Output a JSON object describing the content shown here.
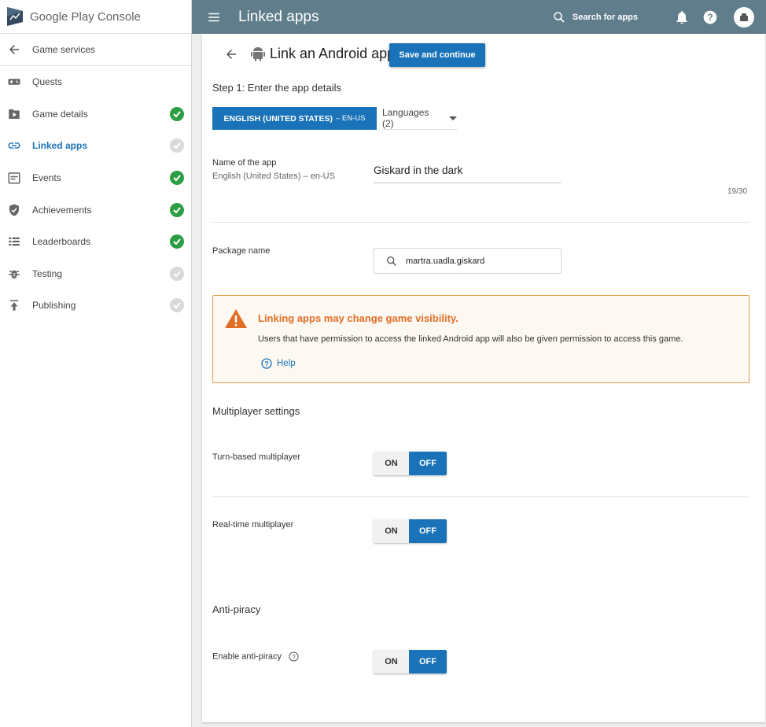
{
  "app": {
    "brand": "Google Play Console"
  },
  "sidebar": {
    "back_label": "Game services",
    "items": [
      {
        "label": "Quests",
        "icon": "gamepad-icon",
        "status": "none"
      },
      {
        "label": "Game details",
        "icon": "play-box-icon",
        "status": "complete"
      },
      {
        "label": "Linked apps",
        "icon": "link-icon",
        "status": "incomplete",
        "active": true
      },
      {
        "label": "Events",
        "icon": "events-icon",
        "status": "complete"
      },
      {
        "label": "Achievements",
        "icon": "shield-icon",
        "status": "complete"
      },
      {
        "label": "Leaderboards",
        "icon": "list-icon",
        "status": "complete"
      },
      {
        "label": "Testing",
        "icon": "bug-icon",
        "status": "incomplete"
      },
      {
        "label": "Publishing",
        "icon": "publish-icon",
        "status": "incomplete"
      }
    ]
  },
  "topbar": {
    "title": "Linked apps",
    "search_label": "Search for apps",
    "color": "#607d8b"
  },
  "page": {
    "title": "Link an Android app",
    "save_label": "Save and continue",
    "step_label": "Step 1: Enter the app details",
    "language_tab": {
      "label": "ENGLISH (UNITED STATES)",
      "suffix": "– EN-US"
    },
    "languages_dropdown": "Languages (2)",
    "app_name": {
      "label": "Name of the app",
      "sublabel": "English (United States) – en-US",
      "value": "Giskard in the dark",
      "counter": "19/30"
    },
    "package": {
      "label": "Package name",
      "value": "martra.uadla.giskard"
    },
    "warning": {
      "title": "Linking apps may change game visibility.",
      "body": "Users that have permission to access the linked Android app will also be given permission to access this game.",
      "help": "Help"
    },
    "multiplayer": {
      "title": "Multiplayer settings",
      "turn_based": {
        "label": "Turn-based multiplayer",
        "on": "ON",
        "off": "OFF",
        "selected": "OFF"
      },
      "real_time": {
        "label": "Real-time multiplayer",
        "on": "ON",
        "off": "OFF",
        "selected": "OFF"
      }
    },
    "antipiracy": {
      "title": "Anti-piracy",
      "enable": {
        "label": "Enable anti-piracy",
        "on": "ON",
        "off": "OFF",
        "selected": "OFF"
      }
    }
  },
  "colors": {
    "accent": "#1a73b8",
    "success": "#2e9e44",
    "warning": "#e06f25"
  }
}
